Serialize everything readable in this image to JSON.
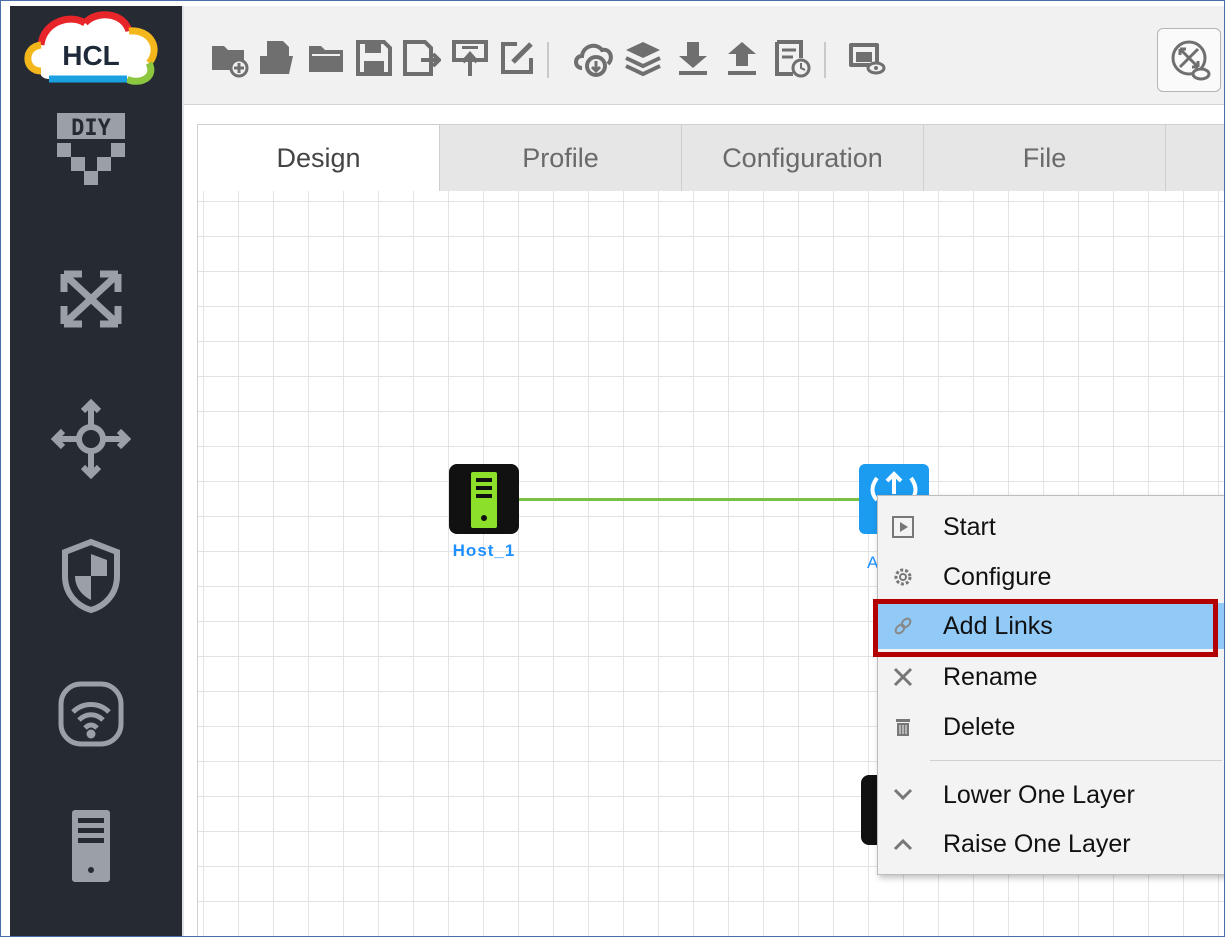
{
  "app": {
    "logo_text": "HCL"
  },
  "sidebar": {
    "items": [
      {
        "name": "diy-icon",
        "label": "DIY"
      },
      {
        "name": "switch-arrows-icon"
      },
      {
        "name": "move-arrows-icon"
      },
      {
        "name": "shield-icon"
      },
      {
        "name": "wifi-icon"
      },
      {
        "name": "server-icon"
      }
    ]
  },
  "toolbar": {
    "buttons": [
      "new-folder-icon",
      "open-file-icon",
      "open-folder-icon",
      "save-icon",
      "save-as-icon",
      "export-icon",
      "edit-icon",
      "cloud-upload-icon",
      "layers-icon",
      "download-icon",
      "upload-icon",
      "history-icon",
      "preview-icon",
      "topology-icon"
    ]
  },
  "tabs": [
    {
      "label": "Design",
      "active": true
    },
    {
      "label": "Profile"
    },
    {
      "label": "Configuration"
    },
    {
      "label": "File"
    }
  ],
  "canvas": {
    "nodes": [
      {
        "label": "Host_1",
        "type": "host"
      },
      {
        "label": "A",
        "type": "wireless-ap"
      }
    ]
  },
  "context_menu": {
    "items": [
      {
        "label": "Start",
        "icon": "play-icon"
      },
      {
        "label": "Configure",
        "icon": "gear-icon"
      },
      {
        "label": "Add Links",
        "icon": "link-icon",
        "highlighted": true
      },
      {
        "label": "Rename",
        "icon": "rename-icon"
      },
      {
        "label": "Delete",
        "icon": "trash-icon"
      },
      {
        "label": "Lower One Layer",
        "icon": "chevron-down-icon"
      },
      {
        "label": "Raise One Layer",
        "icon": "chevron-up-icon"
      }
    ]
  },
  "colors": {
    "sidebar_bg": "#252a33",
    "link": "#7ac143",
    "ap": "#1b9cf0",
    "menu_highlight": "#91c9f7",
    "annotation": "#b30000"
  }
}
